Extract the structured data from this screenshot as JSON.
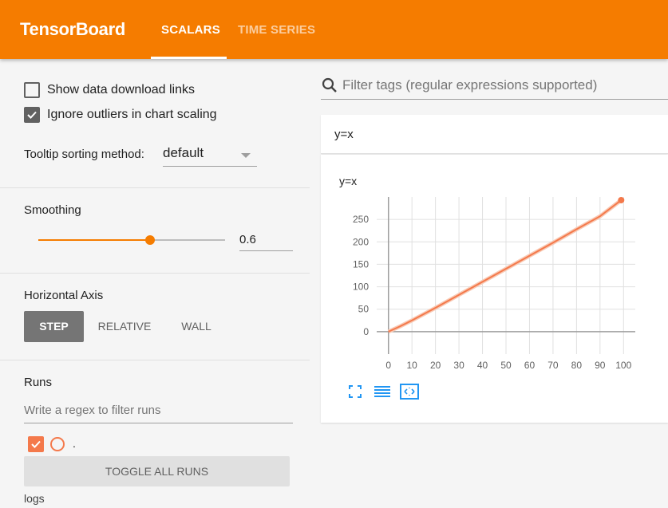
{
  "header": {
    "brand": "TensorBoard",
    "tabs": [
      {
        "label": "SCALARS",
        "active": true
      },
      {
        "label": "TIME SERIES",
        "active": false
      }
    ]
  },
  "sidebar": {
    "show_download_links": {
      "label": "Show data download links",
      "checked": false
    },
    "ignore_outliers": {
      "label": "Ignore outliers in chart scaling",
      "checked": true
    },
    "tooltip_sorting": {
      "label": "Tooltip sorting method:",
      "value": "default"
    },
    "smoothing": {
      "title": "Smoothing",
      "value": "0.6",
      "fraction": 0.6
    },
    "horizontal_axis": {
      "title": "Horizontal Axis",
      "options": [
        {
          "label": "STEP",
          "selected": true
        },
        {
          "label": "RELATIVE",
          "selected": false
        },
        {
          "label": "WALL",
          "selected": false
        }
      ]
    },
    "runs": {
      "title": "Runs",
      "filter_placeholder": "Write a regex to filter runs",
      "items": [
        {
          "name": ".",
          "checked": true,
          "color": "#f4794b"
        }
      ],
      "toggle_label": "TOGGLE ALL RUNS",
      "logdir": "logs"
    }
  },
  "main": {
    "filter_placeholder": "Filter tags (regular expressions supported)",
    "card": {
      "tag": "y=x"
    }
  },
  "colors": {
    "accent": "#f57c00",
    "run": "#f4794b"
  },
  "chart_data": {
    "type": "line",
    "title": "y=x",
    "xlabel": "",
    "ylabel": "",
    "xlim": [
      -5,
      105
    ],
    "ylim": [
      -50,
      300
    ],
    "xticks": [
      0,
      10,
      20,
      30,
      40,
      50,
      60,
      70,
      80,
      90,
      100
    ],
    "yticks": [
      0,
      50,
      100,
      150,
      200,
      250
    ],
    "grid": true,
    "series": [
      {
        "color": "#f4794b",
        "x": [
          0,
          5,
          10,
          20,
          30,
          40,
          50,
          60,
          70,
          80,
          90,
          99
        ],
        "y": [
          0,
          12,
          25,
          53,
          82,
          111,
          140,
          169,
          198,
          228,
          257,
          293
        ]
      }
    ]
  }
}
